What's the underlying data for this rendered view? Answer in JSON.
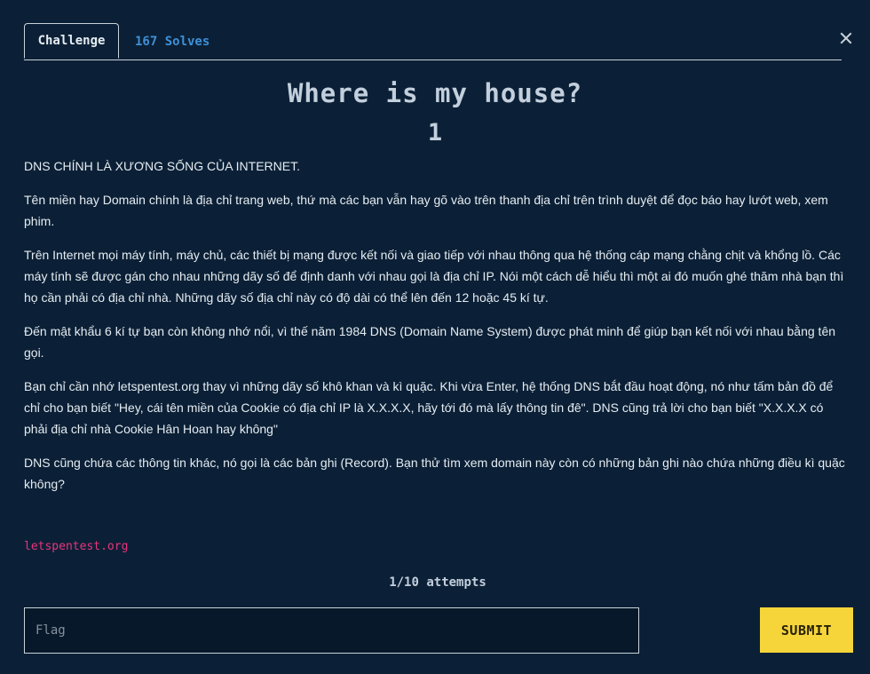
{
  "tabs": {
    "challenge_label": "Challenge",
    "solves_label": "167 Solves"
  },
  "close": {
    "icon": "close-icon"
  },
  "challenge": {
    "title": "Where is my house?",
    "points": "1",
    "description": [
      "DNS CHÍNH LÀ XƯƠNG SỐNG CỦA INTERNET.",
      "Tên miền hay Domain chính là địa chỉ trang web, thứ mà các bạn vẫn hay gõ vào trên thanh địa chỉ trên trình duyệt để đọc báo hay lướt web, xem phim.",
      "Trên Internet mọi máy tính, máy chủ, các thiết bị mạng được kết nối và giao tiếp với nhau thông qua hệ thống cáp mạng chằng chịt và khổng lồ. Các máy tính sẽ được gán cho nhau những dãy số để định danh với nhau gọi là địa chỉ IP. Nói một cách dễ hiểu thì một ai đó muốn ghé thăm nhà bạn thì họ cần phải có địa chỉ nhà. Những dãy số địa chỉ này có độ dài có thể lên đến 12 hoặc 45 kí tự.",
      "Đến mật khẩu 6 kí tự bạn còn không nhớ nổi, vì thế năm 1984 DNS (Domain Name System) được phát minh để giúp bạn kết nối với nhau bằng tên gọi.",
      "Bạn chỉ cần nhớ letspentest.org thay vì những dãy số khô khan và kì quặc. Khi vừa Enter, hệ thống DNS bắt đầu hoạt động, nó như tấm bản đồ để chỉ cho bạn biết \"Hey, cái tên miền của Cookie có địa chỉ IP là X.X.X.X, hãy tới đó mà lấy thông tin đê\". DNS cũng trả lời cho bạn biết \"X.X.X.X có phải địa chỉ nhà Cookie Hân Hoan hay không\"",
      "DNS cũng chứa các thông tin khác, nó gọi là các bản ghi (Record). Bạn thử tìm xem domain này còn có những bản ghi nào chứa những điều kì quặc không?"
    ],
    "link": "letspentest.org",
    "attempts": "1/10 attempts"
  },
  "form": {
    "flag_placeholder": "Flag",
    "flag_value": "",
    "submit_label": "SUBMIT"
  },
  "colors": {
    "background": "#0b2036",
    "accent_blue": "#3f8fd6",
    "link_pink": "#e8347e",
    "submit_yellow": "#f5d53a"
  }
}
